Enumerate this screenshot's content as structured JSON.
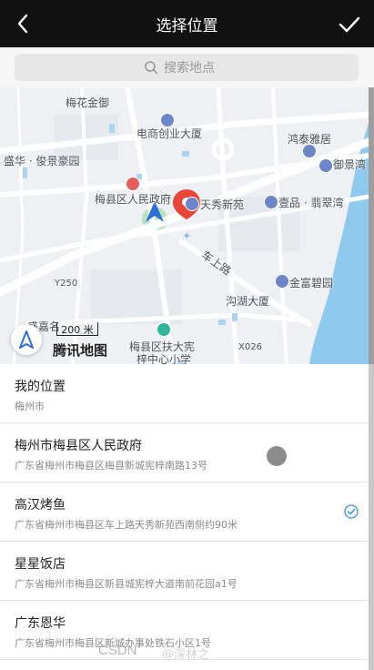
{
  "header": {
    "title": "选择位置"
  },
  "search": {
    "placeholder": "搜索地点"
  },
  "map": {
    "labels": {
      "meihua_jinyu": "梅花金御",
      "dianshang": "电商创业大厦",
      "hongtai": "鸿泰雅居",
      "yujing": "御景湾",
      "shenghua": "盛华 · 俊景豪园",
      "meixian_gov": "梅县区人民政府",
      "tianxiu": "天秀新苑",
      "yipin": "壹品 · 翡翠湾",
      "chechang": "车上路",
      "y250": "Y250",
      "jinfu": "金富碧园",
      "goushi": "沟湖大厦",
      "shengge": "盛嘉名",
      "school": "梅县区扶大宪",
      "school2": "梓中心小学",
      "x026": "X026"
    },
    "scale_text": "200 米",
    "brand": "腾讯地图"
  },
  "places": [
    {
      "name": "我的位置",
      "address": "梅州市"
    },
    {
      "name": "梅州市梅县区人民政府",
      "address": "广东省梅州市梅县区梅县新城宪梓南路13号"
    },
    {
      "name": "高汉烤鱼",
      "address": "广东省梅州市梅县区车上路天秀新苑西南侧约90米"
    },
    {
      "name": "星星饭店",
      "address": "广东省梅州市梅县区新县城宪梓大道南前花园a1号"
    },
    {
      "name": "广东恩华",
      "address": "广东省梅州市梅县区新城办事处铁石小区1号"
    }
  ],
  "watermark": {
    "text": "CSDN",
    "text2": "@深林之"
  },
  "colors": {
    "topbar": "#111111",
    "accent": "#3d8fe0",
    "pin": "#e8443a",
    "water": "#8ec9ee"
  }
}
